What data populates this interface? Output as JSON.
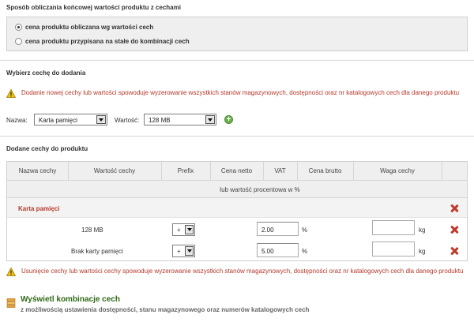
{
  "calc_section": {
    "title": "Sposób obliczania końcowej wartości produktu z cechami",
    "options": [
      {
        "label": "cena produktu obliczana wg wartości cech",
        "checked": true
      },
      {
        "label": "cena produktu przypisana na stałe do kombinacji cech",
        "checked": false
      }
    ]
  },
  "choose_section": {
    "title": "Wybierz cechę do dodania",
    "warning": "Dodanie nowej cechy lub wartości spowoduje wyzerowanie wszystkich stanów magazynowych, dostępności oraz nr katalogowych cech dla danego produktu",
    "name_label": "Nazwa:",
    "name_value": "Karta pamięci",
    "value_label": "Wartość:",
    "value_value": "128 MB",
    "add_icon": "plus-circle-icon"
  },
  "added_section": {
    "title": "Dodane cechy do produktu",
    "columns": [
      "Nazwa cechy",
      "Wartość cechy",
      "Prefix",
      "Cena netto",
      "VAT",
      "Cena brutto",
      "Waga cechy"
    ],
    "subheader": "lub wartość procentowa w %",
    "group": {
      "name": "Karta pamięci",
      "values": [
        {
          "name": "128 MB",
          "prefix": "+",
          "price": "2.00",
          "unit": "%",
          "weight": "",
          "weight_unit": "kg"
        },
        {
          "name": "Brak karty pamięci",
          "prefix": "+",
          "price": "5.00",
          "unit": "%",
          "weight": "",
          "weight_unit": "kg"
        }
      ]
    },
    "warning": "Usunięcie cechy lub wartości cechy spowoduje wyzerowanie wszystkich stanów magazynowych, dostępności oraz nr katalogowych cech dla danego produktu"
  },
  "combinations": {
    "title": "Wyświetl kombinacje cech",
    "subtitle": "z możliwością ustawienia dostępności, stanu magazynowego oraz numerów katalogowych cech"
  },
  "colors": {
    "warning_text": "#b6382b",
    "link_green": "#2f6a18",
    "delete_red": "#c0392b"
  }
}
